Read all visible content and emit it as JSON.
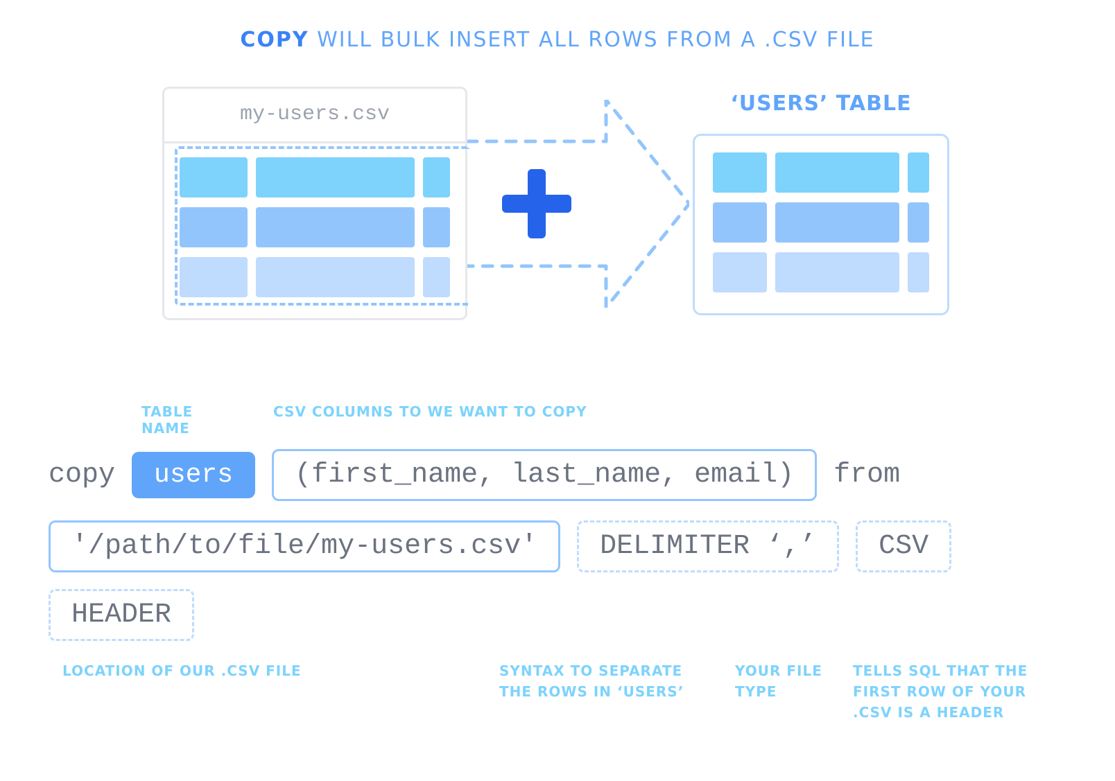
{
  "caption": {
    "strong": "COPY",
    "rest": " WILL BULK INSERT ALL ROWS FROM A .CSV FILE"
  },
  "csv": {
    "filename": "my-users.csv"
  },
  "table": {
    "title": "‘USERS’ TABLE"
  },
  "labels": {
    "table_name": "TABLE NAME",
    "columns": "CSV COLUMNS TO WE WANT TO COPY"
  },
  "syntax": {
    "copy": "copy",
    "table": "users",
    "columns": "(first_name, last_name, email)",
    "from": "from",
    "path": "'/path/to/file/my-users.csv'",
    "delimiter": "DELIMITER ‘,’",
    "csv": "CSV",
    "header": "HEADER"
  },
  "desc": {
    "location": "LOCATION OF OUR .CSV FILE",
    "delimiter": "SYNTAX TO SEPARATE THE ROWS IN ‘USERS’",
    "csv": "YOUR FILE TYPE",
    "header": "TELLS SQL THAT THE FIRST ROW OF YOUR .CSV IS A HEADER"
  }
}
